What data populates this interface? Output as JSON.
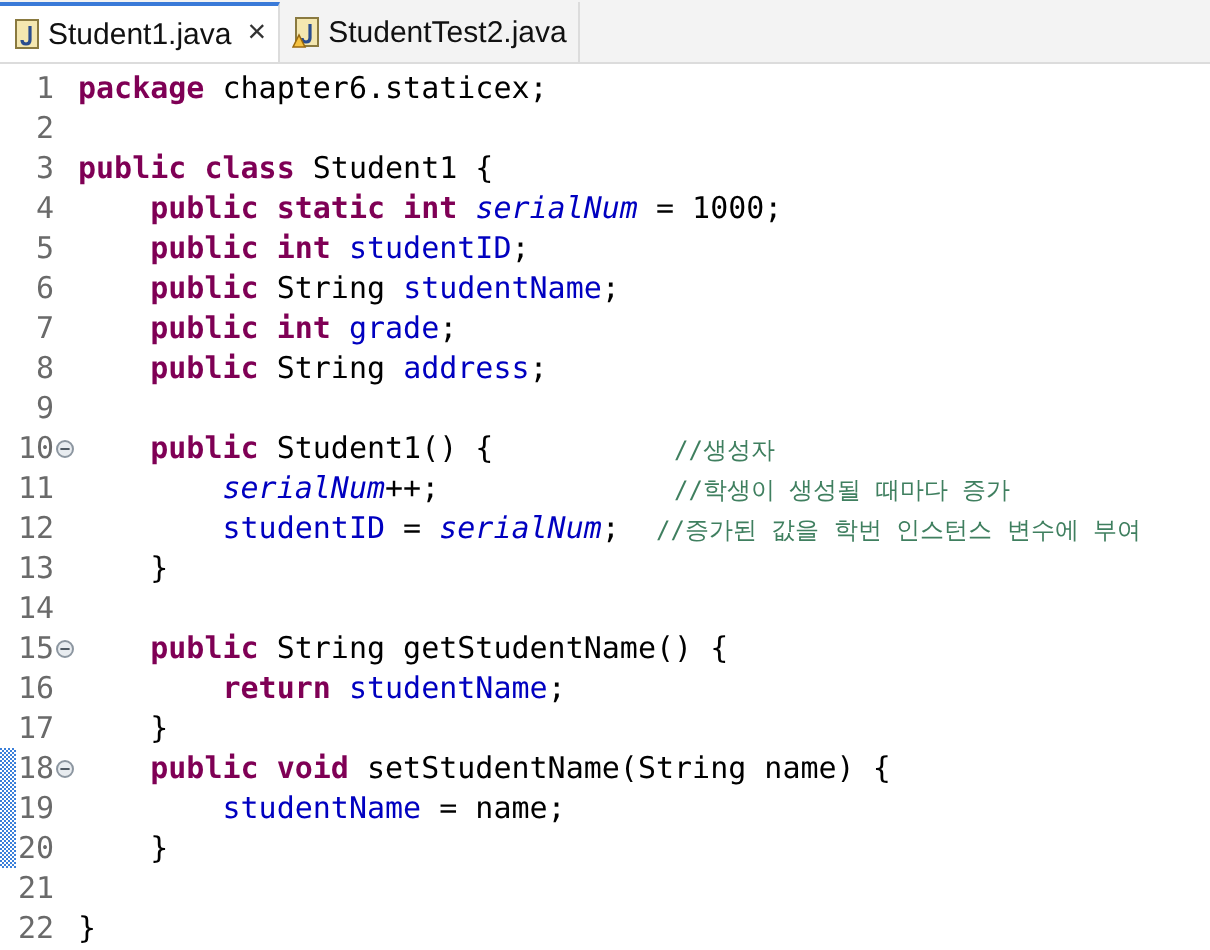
{
  "tabs": [
    {
      "label": "Student1.java",
      "selected": true,
      "warning": false,
      "close": "×"
    },
    {
      "label": "StudentTest2.java",
      "selected": false,
      "warning": true
    }
  ],
  "lines": [
    {
      "number": "1",
      "tokens": [
        {
          "kind": "keyword",
          "text": "package"
        },
        {
          "kind": "plain",
          "text": " chapter6.staticex;"
        }
      ]
    },
    {
      "number": "2"
    },
    {
      "number": "3",
      "tokens": [
        {
          "kind": "keyword",
          "text": "public class"
        },
        {
          "kind": "plain",
          "text": " Student1 {"
        }
      ]
    },
    {
      "number": "4",
      "tokens": [
        {
          "kind": "keyword",
          "text": "    public static int "
        },
        {
          "kind": "static",
          "text": "serialNum"
        },
        {
          "kind": "plain",
          "text": " = 1000;"
        }
      ]
    },
    {
      "number": "5",
      "tokens": [
        {
          "kind": "keyword",
          "text": "    public int "
        },
        {
          "kind": "field",
          "text": "studentID"
        },
        {
          "kind": "plain",
          "text": ";"
        }
      ]
    },
    {
      "number": "6",
      "tokens": [
        {
          "kind": "keyword",
          "text": "    public"
        },
        {
          "kind": "plain",
          "text": " String "
        },
        {
          "kind": "field",
          "text": "studentName"
        },
        {
          "kind": "plain",
          "text": ";"
        }
      ]
    },
    {
      "number": "7",
      "tokens": [
        {
          "kind": "keyword",
          "text": "    public int "
        },
        {
          "kind": "field",
          "text": "grade"
        },
        {
          "kind": "plain",
          "text": ";"
        }
      ]
    },
    {
      "number": "8",
      "tokens": [
        {
          "kind": "keyword",
          "text": "    public"
        },
        {
          "kind": "plain",
          "text": " String "
        },
        {
          "kind": "field",
          "text": "address"
        },
        {
          "kind": "plain",
          "text": ";"
        }
      ]
    },
    {
      "number": "9"
    },
    {
      "number": "10",
      "folded": false,
      "tokens": [
        {
          "kind": "keyword",
          "text": "    public"
        },
        {
          "kind": "plain",
          "text": " Student1() {          "
        },
        {
          "kind": "comment",
          "text": "//생성자"
        }
      ]
    },
    {
      "number": "11",
      "tokens": [
        {
          "kind": "static",
          "text": "        serialNum"
        },
        {
          "kind": "plain",
          "text": "++;             "
        },
        {
          "kind": "comment",
          "text": "//학생이 생성될 때마다 증가"
        }
      ]
    },
    {
      "number": "12",
      "tokens": [
        {
          "kind": "field",
          "text": "        studentID"
        },
        {
          "kind": "plain",
          "text": " = "
        },
        {
          "kind": "static",
          "text": "serialNum"
        },
        {
          "kind": "plain",
          "text": ";  "
        },
        {
          "kind": "comment",
          "text": "//증가된 값을 학번 인스턴스 변수에 부여"
        }
      ]
    },
    {
      "number": "13",
      "tokens": [
        {
          "kind": "plain",
          "text": "    }"
        }
      ]
    },
    {
      "number": "14"
    },
    {
      "number": "15",
      "folded": false,
      "tokens": [
        {
          "kind": "keyword",
          "text": "    public"
        },
        {
          "kind": "plain",
          "text": " String getStudentName() {"
        }
      ]
    },
    {
      "number": "16",
      "tokens": [
        {
          "kind": "keyword",
          "text": "        return "
        },
        {
          "kind": "field",
          "text": "studentName"
        },
        {
          "kind": "plain",
          "text": ";"
        }
      ]
    },
    {
      "number": "17",
      "tokens": [
        {
          "kind": "plain",
          "text": "    }"
        }
      ]
    },
    {
      "number": "18",
      "folded": false,
      "changed": true,
      "tokens": [
        {
          "kind": "keyword",
          "text": "    public void"
        },
        {
          "kind": "plain",
          "text": " setStudentName(String name) {"
        }
      ]
    },
    {
      "number": "19",
      "changed": true,
      "tokens": [
        {
          "kind": "field",
          "text": "        studentName"
        },
        {
          "kind": "plain",
          "text": " = name;"
        }
      ]
    },
    {
      "number": "20",
      "changed": true,
      "tokens": [
        {
          "kind": "plain",
          "text": "    }"
        }
      ]
    },
    {
      "number": "21"
    },
    {
      "number": "22",
      "tokens": [
        {
          "kind": "plain",
          "text": "}"
        }
      ]
    }
  ]
}
